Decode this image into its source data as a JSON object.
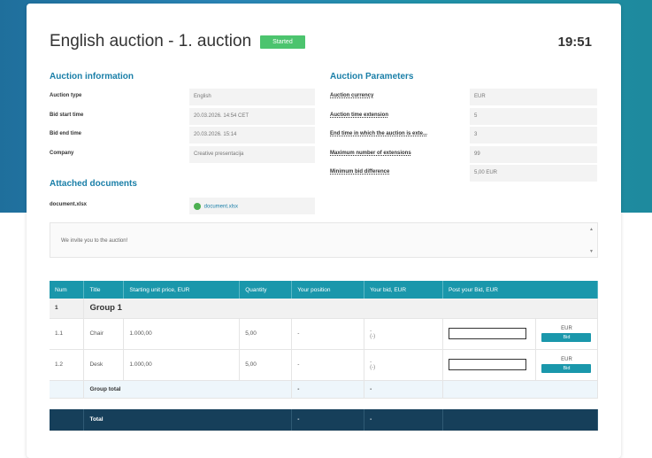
{
  "header": {
    "title": "English auction - 1. auction",
    "status": "Started",
    "clock": "19:51"
  },
  "auction_information": {
    "title": "Auction information",
    "rows": [
      {
        "label": "Auction type",
        "value": "English"
      },
      {
        "label": "Bid start time",
        "value": "20.03.2026. 14:54 CET"
      },
      {
        "label": "Bid end time",
        "value": "20.03.2026. 15:14"
      },
      {
        "label": "Company",
        "value": "Creative presentacija"
      }
    ]
  },
  "auction_parameters": {
    "title": "Auction Parameters",
    "rows": [
      {
        "label": "Auction currency",
        "value": "EUR"
      },
      {
        "label": "Auction time extension",
        "value": "5"
      },
      {
        "label": "End time in which the auction is exte...",
        "value": "3"
      },
      {
        "label": "Maximum number of extensions",
        "value": "99"
      },
      {
        "label": "Minimum bid difference",
        "value": "5,00 EUR"
      }
    ]
  },
  "attached_documents": {
    "title": "Attached documents",
    "file_label": "document.xlsx",
    "file_link": "document.xlsx"
  },
  "message": {
    "text": "We invite you to the auction!",
    "scroll_up": "▲",
    "scroll_down": "▼"
  },
  "table": {
    "headers": [
      "Num",
      "Title",
      "Starting unit price, EUR",
      "Quantity",
      "Your position",
      "Your bid, EUR",
      "Post your Bid, EUR"
    ],
    "group": {
      "num": "1",
      "name": "Group 1"
    },
    "items": [
      {
        "num": "1.1",
        "title": "Chair",
        "price": "1.000,00",
        "qty": "5,00",
        "position": "-",
        "bid": "-",
        "bid_sub": "(-)",
        "currency": "EUR",
        "button": "Bid"
      },
      {
        "num": "1.2",
        "title": "Desk",
        "price": "1.000,00",
        "qty": "5,00",
        "position": "-",
        "bid": "-",
        "bid_sub": "(-)",
        "currency": "EUR",
        "button": "Bid"
      }
    ],
    "group_total": {
      "label": "Group total",
      "position": "-",
      "bid": "-"
    },
    "total": {
      "label": "Total",
      "position": "-",
      "bid": "-"
    }
  },
  "colors": {
    "accent": "#1a97ab",
    "section_title": "#1a7fa8",
    "status_green": "#4cc46e",
    "total_bg": "#163f5a"
  }
}
